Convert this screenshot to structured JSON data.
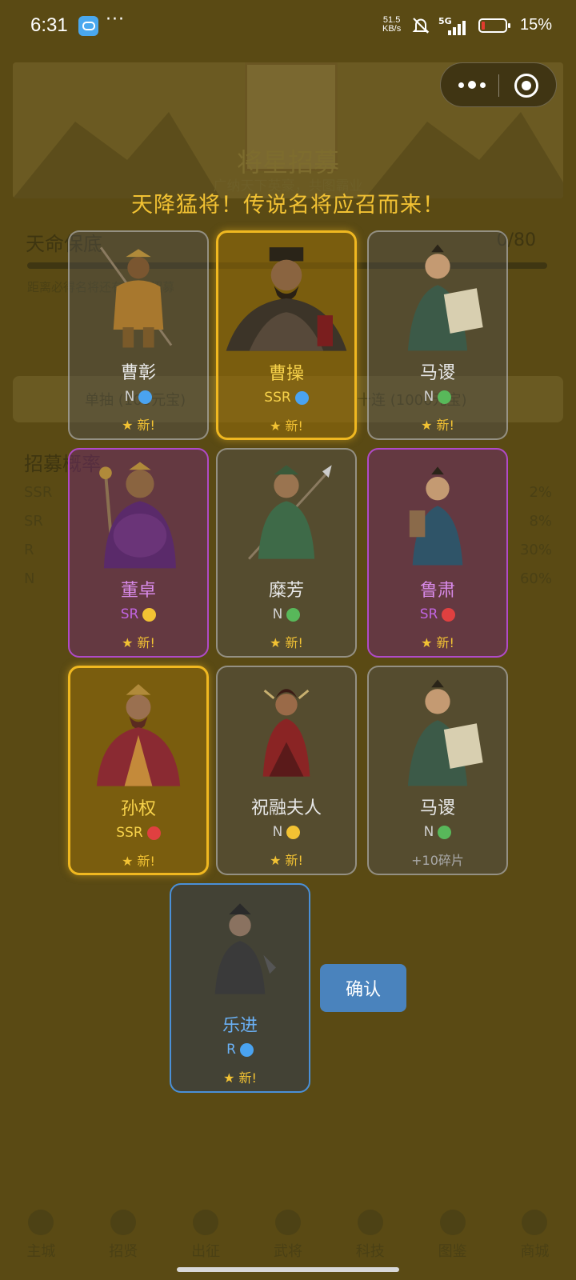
{
  "status_bar": {
    "time": "6:31",
    "more": "···",
    "net_speed_value": "51.5",
    "net_speed_unit": "KB/s",
    "signal_label": "5G",
    "battery_percent": "15%",
    "battery_level": 0.15
  },
  "background": {
    "banner_title": "将星招募",
    "banner_subtitle": "广纳天下英豪，共图霸业",
    "pity_title": "天命保底",
    "pity_count": "0/80",
    "pity_hint": "距离必得名将还有80次招募",
    "single_draw": "单抽 (100元宝)",
    "ten_draw": "十连 (1000元宝)",
    "rates_title": "招募概率",
    "rates": [
      {
        "tier": "SSR",
        "pct": "2%"
      },
      {
        "tier": "SR",
        "pct": "8%"
      },
      {
        "tier": "R",
        "pct": "30%"
      },
      {
        "tier": "N",
        "pct": "60%"
      }
    ],
    "tabs": [
      "主城",
      "招贤",
      "出征",
      "武将",
      "科技",
      "图鉴",
      "商城"
    ]
  },
  "headline": "天降猛将！传说名将应召而来！",
  "cards": [
    {
      "name": "曹彰",
      "rarity": "N",
      "dot_color": "#4aa3f0",
      "status": "★ 新!"
    },
    {
      "name": "曹操",
      "rarity": "SSR",
      "dot_color": "#4aa3f0",
      "status": "★ 新!"
    },
    {
      "name": "马谡",
      "rarity": "N",
      "dot_color": "#58b85a",
      "status": "★ 新!"
    },
    {
      "name": "董卓",
      "rarity": "SR",
      "dot_color": "#f2c233",
      "status": "★ 新!"
    },
    {
      "name": "糜芳",
      "rarity": "N",
      "dot_color": "#58b85a",
      "status": "★ 新!"
    },
    {
      "name": "鲁肃",
      "rarity": "SR",
      "dot_color": "#e04040",
      "status": "★ 新!"
    },
    {
      "name": "孙权",
      "rarity": "SSR",
      "dot_color": "#e04040",
      "status": "★ 新!"
    },
    {
      "name": "祝融夫人",
      "rarity": "N",
      "dot_color": "#f2c233",
      "status": "★ 新!"
    },
    {
      "name": "马谡",
      "rarity": "N",
      "dot_color": "#58b85a",
      "status": "+10碎片"
    },
    {
      "name": "乐进",
      "rarity": "R",
      "dot_color": "#4aa3f0",
      "status": "★ 新!"
    }
  ],
  "confirm_label": "确认",
  "colors": {
    "ssr_border": "#f0b820",
    "sr_border": "#b04ac8",
    "r_border": "#4a90d8",
    "headline": "#f2c233"
  }
}
